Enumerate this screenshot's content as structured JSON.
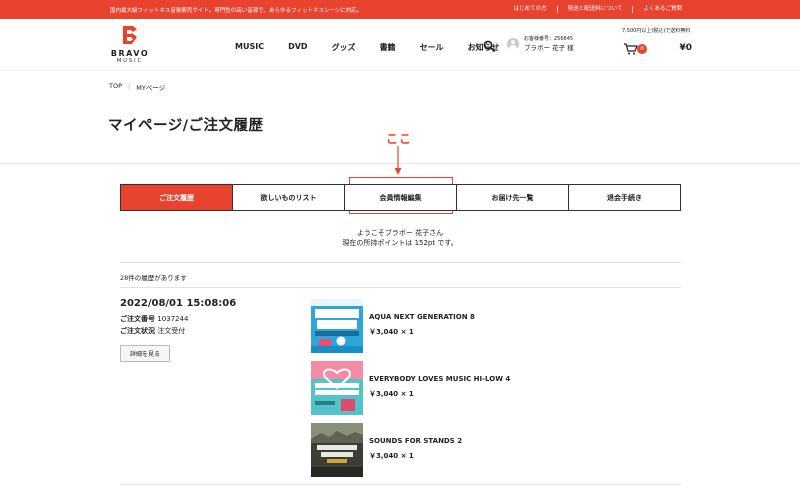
{
  "topbar": {
    "notice": "国内最大級フィットネス音楽販売サイト。専門性の高い音源で、あらゆるフィットネスシーンに対応。",
    "links": [
      "はじめての方",
      "発送と配送料について",
      "よくあるご質問"
    ]
  },
  "logo": {
    "brand": "BRAVO",
    "sub": "MUSIC"
  },
  "nav": [
    "MUSIC",
    "DVD",
    "グッズ",
    "書籍",
    "セール",
    "お知らせ"
  ],
  "user": {
    "customer_no": "お客様番号：256845",
    "name": "ブラボー 花子 様"
  },
  "cart": {
    "shipping_note": "7,500円以上(税込)で送料無料",
    "count": "0",
    "total": "¥0"
  },
  "breadcrumb": [
    "TOP",
    "MYページ"
  ],
  "page_title": "マイページ/ご注文履歴",
  "annotation": {
    "text": "ここ",
    "color": "#e8432f"
  },
  "tabs": [
    {
      "label": "ご注文履歴",
      "active": true
    },
    {
      "label": "欲しいものリスト",
      "active": false
    },
    {
      "label": "会員情報編集",
      "active": false
    },
    {
      "label": "お届け先一覧",
      "active": false
    },
    {
      "label": "退会手続き",
      "active": false
    }
  ],
  "welcome": {
    "line1": "ようこそブラボー 花子さん",
    "line2": "現在の所持ポイントは 152pt です。"
  },
  "history_count": "28件の履歴があります",
  "order": {
    "date": "2022/08/01 15:08:06",
    "number_label": "ご注文番号",
    "number": "1037244",
    "status_label": "ご注文状況",
    "status": "注文受付",
    "detail_button": "詳細を見る",
    "items": [
      {
        "name": "AQUA NEXT GENERATION 8",
        "price": "￥3,040 × 1",
        "cover": "aqua-next-cover"
      },
      {
        "name": "EVERYBODY LOVES MUSIC HI-LOW 4",
        "price": "￥3,040 × 1",
        "cover": "everybody-loves-cover"
      },
      {
        "name": "SOUNDS FOR STANDS 2",
        "price": "￥3,040 × 1",
        "cover": "sounds-for-stands-cover"
      }
    ]
  },
  "colors": {
    "accent": "#e8432f",
    "text": "#222222",
    "border": "#333333"
  }
}
